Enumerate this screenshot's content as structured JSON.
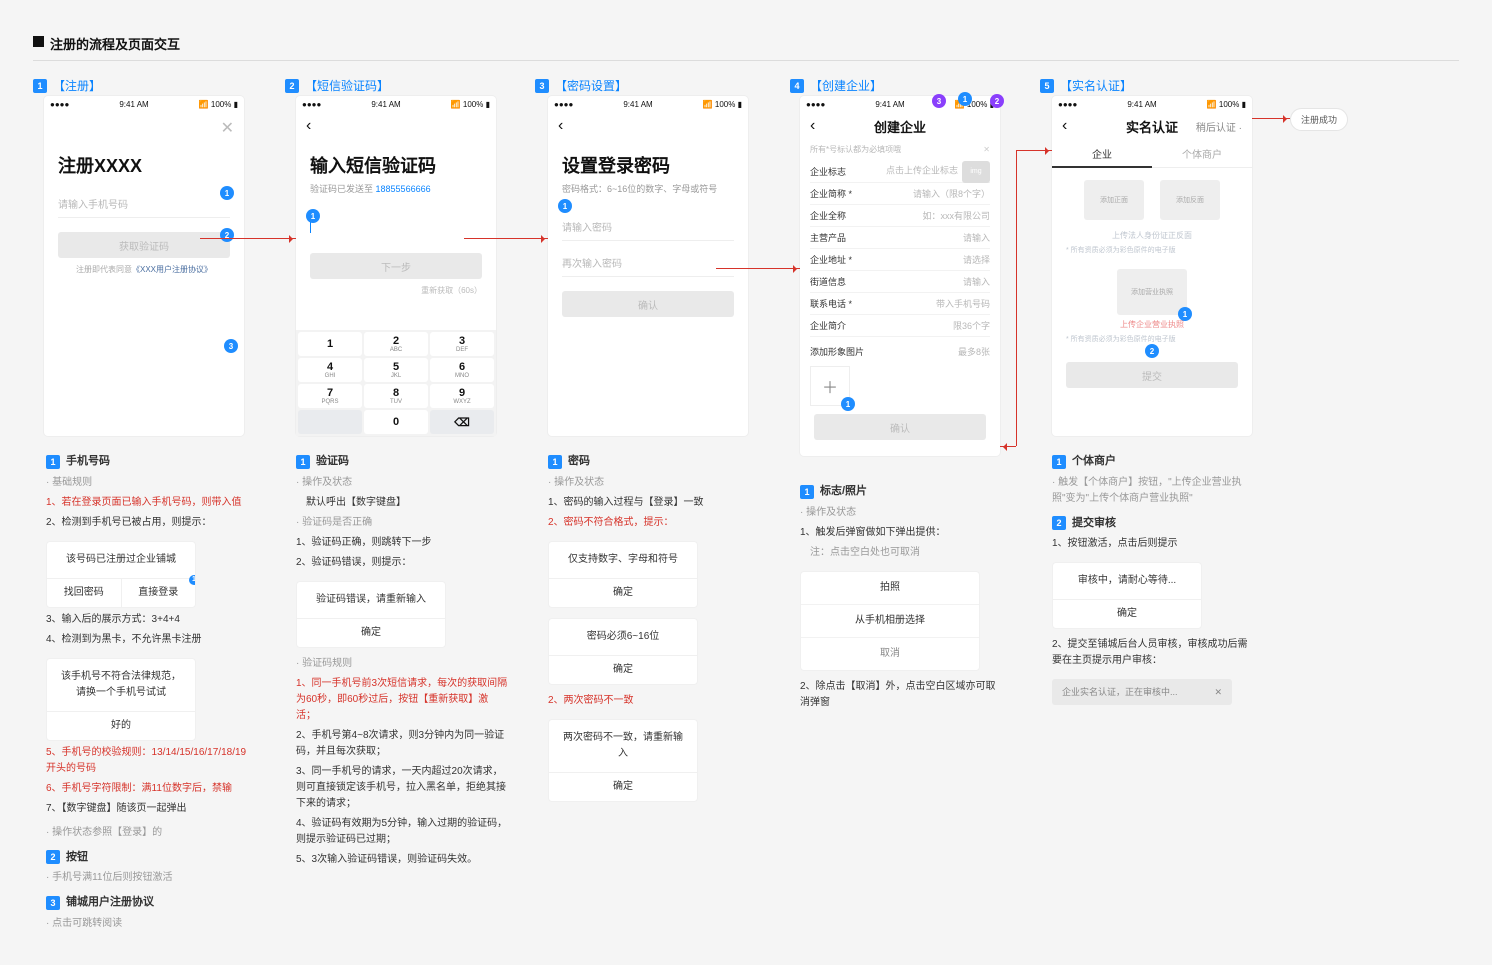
{
  "page_title": "注册的流程及页面交互",
  "steps": [
    "【注册】",
    "【短信验证码】",
    "【密码设置】",
    "【创建企业】",
    "【实名认证】"
  ],
  "status": {
    "signal": "●●●●",
    "time": "9:41 AM",
    "bat": "100%"
  },
  "s1": {
    "title": "注册XXXX",
    "ph": "请输入手机号码",
    "btn": "获取验证码",
    "agree_a": "注册即代表同意",
    "agree_b": "《XXX用户注册协议》"
  },
  "s2": {
    "title": "输入短信验证码",
    "sub_a": "验证码已发送至",
    "sub_b": "18855566666",
    "btn": "下一步",
    "resend": "重新获取（60s）"
  },
  "s3": {
    "title": "设置登录密码",
    "sub": "密码格式：6~16位的数字、字母或符号",
    "ph1": "请输入密码",
    "ph2": "再次输入密码",
    "btn": "确认"
  },
  "s4": {
    "navtitle": "创建企业",
    "topnote": "所有*号标认都为必填项哦",
    "rows": {
      "logo_l": "企业标志",
      "logo_v": "点击上传企业标志",
      "sname_l": "企业简称 *",
      "sname_v": "请输入（限8个字）",
      "fname_l": "企业全称",
      "fname_v": "如：xxx有限公司",
      "prod_l": "主营产品",
      "prod_v": "请输入",
      "addr_l": "企业地址 *",
      "addr_v": "请选择",
      "street_l": "街道信息",
      "street_v": "请输入",
      "phone_l": "联系电话 *",
      "phone_v": "带入手机号码",
      "intro_l": "企业简介",
      "intro_v": "限36个字",
      "imgs_l": "添加形象图片",
      "imgs_v": "最多8张"
    },
    "btn": "确认"
  },
  "s5": {
    "navtitle": "实名认证",
    "navright": "稍后认证",
    "tab1": "企业",
    "tab2": "个体商户",
    "card_front": "添加正面",
    "card_back": "添加反面",
    "cap1": "上传法人身份证正反面",
    "must1": "* 所有资质必须为彩色原件的电子版",
    "lic": "添加营业执照",
    "cap2": "上传企业营业执照",
    "must2": "* 所有资质必须为彩色原件的电子版",
    "btn": "提交"
  },
  "success_pill": "注册成功",
  "notes": {
    "n1": {
      "h": "手机号码",
      "sub": "基础规则",
      "i1": "1、若在登录页面已输入手机号码，则带入值",
      "i2": "2、检测到手机号已被占用，则提示：",
      "dlg1_msg": "该号码已注册过企业铺城",
      "dlg1_b1": "找回密码",
      "dlg1_b2": "直接登录",
      "i3": "3、输入后的展示方式：3+4+4",
      "i4": "4、检测到为黑卡，不允许黑卡注册",
      "dlg2_msg": "该手机号不符合法律规范，请换一个手机号试试",
      "dlg2_b": "好的",
      "i5": "5、手机号的校验规则：13/14/15/16/17/18/19 开头的号码",
      "i6": "6、手机号字符限制：满11位数字后，禁输",
      "i7": "7、【数字键盘】随该页一起弹出",
      "i8": "操作状态参照【登录】的"
    },
    "n2": {
      "h": "按钮",
      "i1": "手机号满11位后则按钮激活"
    },
    "n3": {
      "h": "铺城用户注册协议",
      "i1": "点击可跳转阅读"
    },
    "c2": {
      "h": "验证码",
      "sub1": "操作及状态",
      "i0a": "默认呼出【数字键盘】",
      "sub2": "验证码是否正确",
      "i1": "1、验证码正确，则跳转下一步",
      "i2": "2、验证码错误，则提示：",
      "dlg1_msg": "验证码错误，请重新输入",
      "dlg1_b": "确定",
      "sub3": "验证码规则",
      "r1": "1、同一手机号前3次短信请求，每次的获取间隔为60秒，即60秒过后，按钮【重新获取】激活；",
      "r2": "2、手机号第4~8次请求，则3分钟内为同一验证码，并且每次获取；",
      "r3": "3、同一手机号的请求，一天内超过20次请求，则可直接锁定该手机号，拉入黑名单，拒绝其接下来的请求；",
      "r4": "4、验证码有效期为5分钟，输入过期的验证码，则提示验证码已过期；",
      "r5": "5、3次输入验证码错误，则验证码失效。"
    },
    "c3": {
      "h": "密码",
      "sub": "操作及状态",
      "i1": "1、密码的输入过程与【登录】一致",
      "i2": "2、密码不符合格式，提示：",
      "d1_msg": "仅支持数字、字母和符号",
      "d1_b": "确定",
      "d2_msg": "密码必须6~16位",
      "d2_b": "确定",
      "i3": "2、两次密码不一致",
      "d3_msg": "两次密码不一致，请重新输入",
      "d3_b": "确定"
    },
    "c4": {
      "h": "标志/照片",
      "sub": "操作及状态",
      "i1": "1、触发后弹窗做如下弹出提供：",
      "i1b": "注：点击空白处也可取消",
      "sh1": "拍照",
      "sh2": "从手机相册选择",
      "sh3": "取消",
      "i2": "2、除点击【取消】外，点击空白区域亦可取消弹窗"
    },
    "c5": {
      "h1": "个体商户",
      "i1a": "触发【个体商户】按钮，\"上传企业营业执照\"变为\"上传个体商户营业执照\"",
      "h2": "提交审核",
      "i2a": "1、按钮激活，点击后则提示",
      "d_msg": "审核中，请耐心等待...",
      "d_b": "确定",
      "i2b": "2、提交至铺城后台人员审核，审核成功后需要在主页提示用户审核：",
      "toast": "企业实名认证，正在审核中..."
    }
  },
  "keypad": {
    "k1": "1",
    "k2": "2",
    "k2s": "ABC",
    "k3": "3",
    "k3s": "DEF",
    "k4": "4",
    "k4s": "GHI",
    "k5": "5",
    "k5s": "JKL",
    "k6": "6",
    "k6s": "MNO",
    "k7": "7",
    "k7s": "PQRS",
    "k8": "8",
    "k8s": "TUV",
    "k9": "9",
    "k9s": "WXYZ",
    "k0": "0"
  }
}
